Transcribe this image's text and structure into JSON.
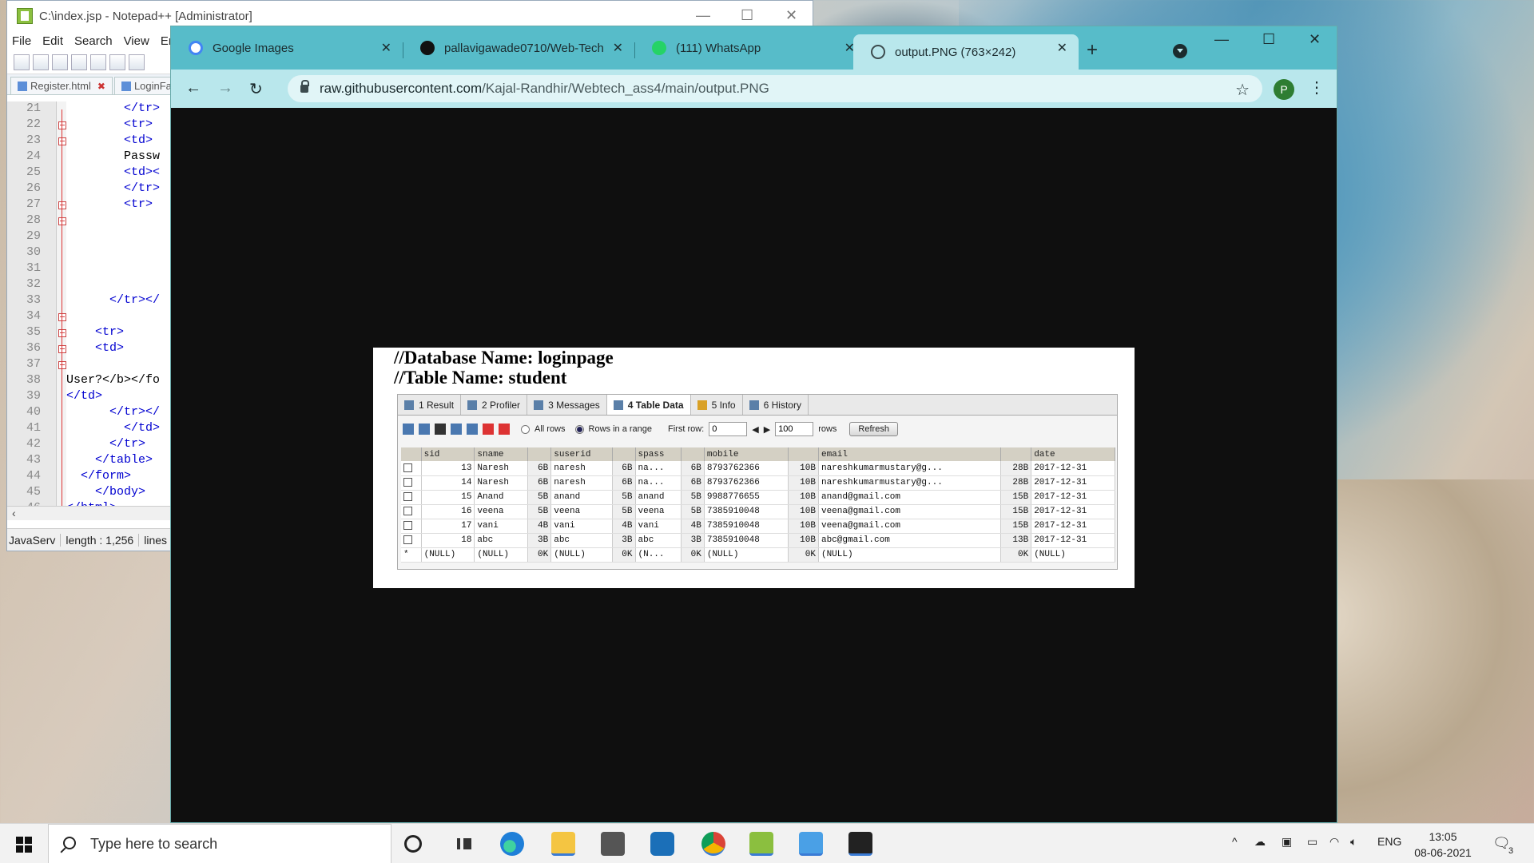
{
  "notepad": {
    "title": "C:\\index.jsp - Notepad++ [Administrator]",
    "menu": [
      "File",
      "Edit",
      "Search",
      "View",
      "En"
    ],
    "tabs": [
      "Register.html",
      "LoginFa"
    ],
    "lines": [
      {
        "n": "21",
        "code": "        </tr>"
      },
      {
        "n": "22",
        "code": "        <tr>"
      },
      {
        "n": "23",
        "code": "        <td>"
      },
      {
        "n": "24",
        "code": "        Passw"
      },
      {
        "n": "25",
        "code": "        <td><"
      },
      {
        "n": "26",
        "code": "        </tr>"
      },
      {
        "n": "27",
        "code": "        <tr>"
      },
      {
        "n": "28",
        "code": ""
      },
      {
        "n": "29",
        "code": ""
      },
      {
        "n": "30",
        "code": ""
      },
      {
        "n": "31",
        "code": ""
      },
      {
        "n": "32",
        "code": ""
      },
      {
        "n": "33",
        "code": "      </tr></"
      },
      {
        "n": "34",
        "code": ""
      },
      {
        "n": "35",
        "code": "    <tr>"
      },
      {
        "n": "36",
        "code": "    <td>"
      },
      {
        "n": "37",
        "code": ""
      },
      {
        "n": "38",
        "code": "User?</b></fo"
      },
      {
        "n": "39",
        "code": "</td>"
      },
      {
        "n": "40",
        "code": "      </tr></"
      },
      {
        "n": "41",
        "code": "        </td>"
      },
      {
        "n": "42",
        "code": "      </tr>"
      },
      {
        "n": "43",
        "code": "    </table>"
      },
      {
        "n": "44",
        "code": "  </form>"
      },
      {
        "n": "45",
        "code": "    </body>"
      },
      {
        "n": "46",
        "code": "</html>"
      }
    ],
    "status": [
      "JavaServ",
      "length : 1,256",
      "lines"
    ]
  },
  "browser": {
    "tabs": [
      {
        "title": "Google Images",
        "icon": "google-icon",
        "color": "#4285f4"
      },
      {
        "title": "pallavigawade0710/Web-Tech",
        "icon": "github-icon",
        "color": "#111111"
      },
      {
        "title": "(111) WhatsApp",
        "icon": "whatsapp-icon",
        "color": "#25d366"
      },
      {
        "title": "output.PNG (763×242)",
        "icon": "globe-icon",
        "color": "#3c4b4e"
      }
    ],
    "new_tab": "+",
    "address": {
      "host": "raw.githubusercontent.com",
      "path": "/Kajal-Randhir/Webtech_ass4/main/output.PNG"
    },
    "profile_initial": "P"
  },
  "image": {
    "heading1": "//Database Name: loginpage",
    "heading2": "//Table Name: student",
    "result_tabs": [
      "1 Result",
      "2 Profiler",
      "3 Messages",
      "4 Table Data",
      "5 Info",
      "6 History"
    ],
    "toolbar": {
      "all_rows": "All rows",
      "rows_in_range": "Rows in a range",
      "first_row_label": "First row:",
      "first_row_value": "0",
      "count_value": "100",
      "rows_label": "rows",
      "refresh": "Refresh"
    },
    "columns": [
      "sid",
      "sname",
      "",
      "suserid",
      "",
      "spass",
      "",
      "mobile",
      "",
      "email",
      "",
      "date"
    ],
    "rows": [
      [
        "13",
        "Naresh",
        "6B",
        "naresh",
        "6B",
        "na...",
        "6B",
        "8793762366",
        "10B",
        "nareshkumarmustary@g...",
        "28B",
        "2017-12-31"
      ],
      [
        "14",
        "Naresh",
        "6B",
        "naresh",
        "6B",
        "na...",
        "6B",
        "8793762366",
        "10B",
        "nareshkumarmustary@g...",
        "28B",
        "2017-12-31"
      ],
      [
        "15",
        "Anand",
        "5B",
        "anand",
        "5B",
        "anand",
        "5B",
        "9988776655",
        "10B",
        "anand@gmail.com",
        "15B",
        "2017-12-31"
      ],
      [
        "16",
        "veena",
        "5B",
        "veena",
        "5B",
        "veena",
        "5B",
        "7385910048",
        "10B",
        "veena@gmail.com",
        "15B",
        "2017-12-31"
      ],
      [
        "17",
        "vani",
        "4B",
        "vani",
        "4B",
        "vani",
        "4B",
        "7385910048",
        "10B",
        "veena@gmail.com",
        "15B",
        "2017-12-31"
      ],
      [
        "18",
        "abc",
        "3B",
        "abc",
        "3B",
        "abc",
        "3B",
        "7385910048",
        "10B",
        "abc@gmail.com",
        "13B",
        "2017-12-31"
      ]
    ],
    "null_row": [
      "(NULL)",
      "(NULL)",
      "0K",
      "(NULL)",
      "0K",
      "(N...",
      "0K",
      "(NULL)",
      "0K",
      "(NULL)",
      "0K",
      "(NULL)"
    ],
    "null_marker": "*"
  },
  "taskbar": {
    "search_placeholder": "Type here to search",
    "language": "ENG",
    "time": "13:05",
    "date": "08-06-2021",
    "notification_count": "3"
  }
}
